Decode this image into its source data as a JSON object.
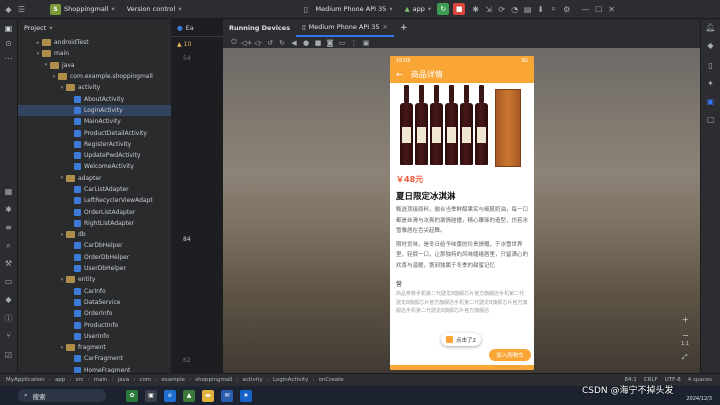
{
  "titlebar": {
    "project_letter": "S",
    "project_name": "Shoppingmall",
    "vcs": "Version control",
    "device": "Medium Phone API 35",
    "run_config": "app"
  },
  "project_panel": {
    "title": "Project",
    "rows": [
      {
        "label": "androidTest",
        "indent": 3,
        "kind": "folder",
        "open": false
      },
      {
        "label": "main",
        "indent": 3,
        "kind": "folder",
        "open": true
      },
      {
        "label": "java",
        "indent": 4,
        "kind": "folder",
        "open": true
      },
      {
        "label": "com.example.shoppingmall",
        "indent": 5,
        "kind": "folder",
        "open": true
      },
      {
        "label": "activity",
        "indent": 6,
        "kind": "folder",
        "open": true
      },
      {
        "label": "AboutActivity",
        "indent": 7,
        "kind": "class"
      },
      {
        "label": "LoginActivity",
        "indent": 7,
        "kind": "class",
        "selected": true
      },
      {
        "label": "MainActivity",
        "indent": 7,
        "kind": "class"
      },
      {
        "label": "ProductDetailActivity",
        "indent": 7,
        "kind": "class"
      },
      {
        "label": "RegisterActivity",
        "indent": 7,
        "kind": "class"
      },
      {
        "label": "UpdatePwdActivity",
        "indent": 7,
        "kind": "class"
      },
      {
        "label": "WelcomeActivity",
        "indent": 7,
        "kind": "class"
      },
      {
        "label": "adapter",
        "indent": 6,
        "kind": "folder",
        "open": true
      },
      {
        "label": "CarListAdapter",
        "indent": 7,
        "kind": "class"
      },
      {
        "label": "LeftRecyclerViewAdapt",
        "indent": 7,
        "kind": "class"
      },
      {
        "label": "OrderListAdapter",
        "indent": 7,
        "kind": "class"
      },
      {
        "label": "RightListAdapter",
        "indent": 7,
        "kind": "class"
      },
      {
        "label": "db",
        "indent": 6,
        "kind": "folder",
        "open": true
      },
      {
        "label": "CarDbHelper",
        "indent": 7,
        "kind": "class"
      },
      {
        "label": "OrderDbHelper",
        "indent": 7,
        "kind": "class"
      },
      {
        "label": "UserDbHelper",
        "indent": 7,
        "kind": "class"
      },
      {
        "label": "entity",
        "indent": 6,
        "kind": "folder",
        "open": true
      },
      {
        "label": "CarInfo",
        "indent": 7,
        "kind": "class"
      },
      {
        "label": "DataService",
        "indent": 7,
        "kind": "class"
      },
      {
        "label": "OrderInfo",
        "indent": 7,
        "kind": "class"
      },
      {
        "label": "ProductInfo",
        "indent": 7,
        "kind": "class"
      },
      {
        "label": "UserInfo",
        "indent": 7,
        "kind": "class"
      },
      {
        "label": "fragment",
        "indent": 6,
        "kind": "folder",
        "open": true
      },
      {
        "label": "CarFragment",
        "indent": 7,
        "kind": "class"
      },
      {
        "label": "HomeFragment",
        "indent": 7,
        "kind": "class"
      }
    ]
  },
  "editor": {
    "tab_label": "Ea",
    "warnings": "10",
    "line_numbers": [
      "54",
      "84",
      "62"
    ]
  },
  "running_devices": {
    "title": "Running Devices",
    "device_tab": "Medium Phone API 35"
  },
  "phone": {
    "status_time": "10:05",
    "status_right": "3G",
    "appbar_title": "商品详情",
    "price": "￥48元",
    "product_title": "夏日限定冰淇淋",
    "desc_1": "甄选顶级原料，融合当季鲜醇果实与细腻奶油，每一口都是丝滑与冰爽的激情碰撞，精心雕琢的造型，仿若冰雪雅居在舌尖起舞。",
    "desc_2": "限时贡味，是冬日给予味蕾的珍贵馈赠，于冰雪世界里，轻抿一口，让那独特的风味缱绻唇里，只留满心的欢喜与温暖，镌刻独属于冬季的甜蜜记忆",
    "section_label": "营",
    "grey_text": "商品参数手机第二代骁龙8旗舰芯片官方旗舰店手机第二代骁龙8旗舰芯片官方旗舰店手机第二代骁龙8旗舰芯片官方旗舰店手机第二代骁龙8旗舰芯片官方旗舰店",
    "float_btn": "点击了2",
    "cart_btn": "加入购物车"
  },
  "breadcrumbs": {
    "items": [
      "MyApplication",
      "app",
      "src",
      "main",
      "java",
      "com",
      "example",
      "shoppingmall",
      "activity",
      "LoginActivity",
      "onCreate"
    ],
    "position": "84:1",
    "line_sep": "CRLF",
    "encoding": "UTF-8",
    "indent": "4 spaces"
  },
  "taskbar": {
    "search_label": "搜索",
    "date": "2024/12/3"
  },
  "watermark": "CSDN @海宁不掉头发",
  "colors": {
    "accent_orange": "#f9a637",
    "price_red": "#f05a3a",
    "run_green": "#3f9b4f",
    "stop_red": "#d8453a",
    "selection_blue": "#3574f0"
  }
}
